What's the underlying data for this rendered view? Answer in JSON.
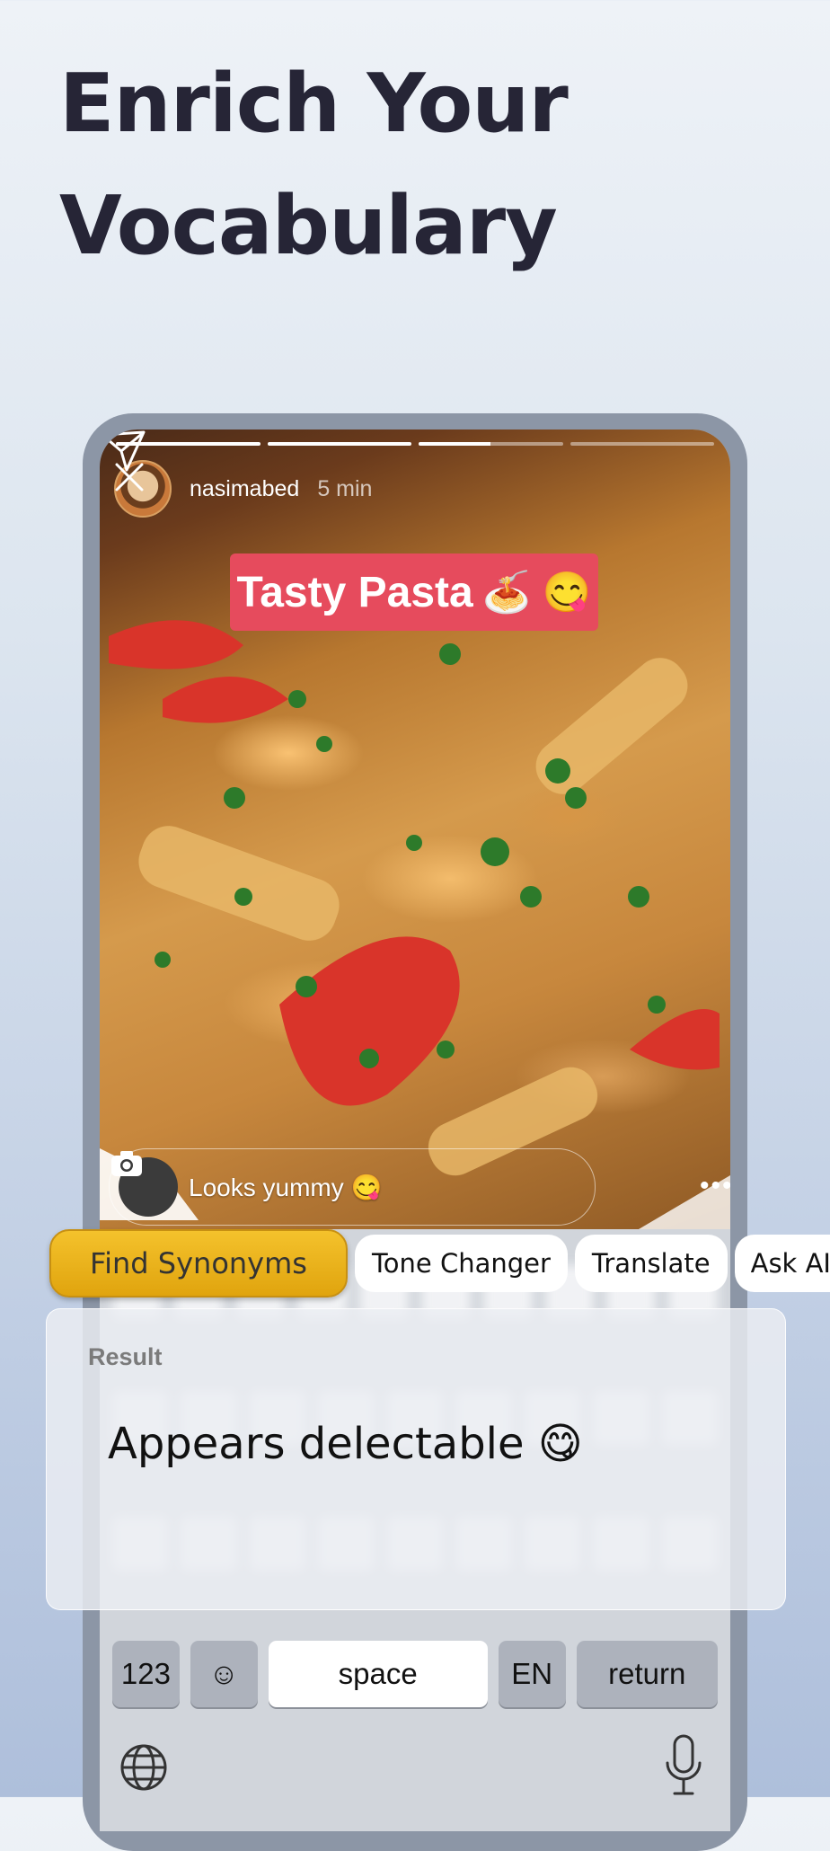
{
  "headline": {
    "line1": "Enrich Your",
    "line2": "Vocabulary"
  },
  "story": {
    "progress": [
      1.0,
      1.0,
      0.5,
      0.0
    ],
    "username": "nasimabed",
    "time": "5 min",
    "sticker_text": "Tasty Pasta",
    "sticker_emojis": "🍝 😋",
    "reply_text": "Looks yummy 😋"
  },
  "chips": [
    {
      "label": "Find Synonyms",
      "active": true
    },
    {
      "label": "Tone Changer",
      "active": false
    },
    {
      "label": "Translate",
      "active": false
    },
    {
      "label": "Ask AI",
      "active": false
    }
  ],
  "result": {
    "label": "Result",
    "text": "Appears delectable 😋"
  },
  "keyboard": {
    "numbers": "123",
    "emoji": "☺",
    "space": "space",
    "lang": "EN",
    "return": "return"
  },
  "colors": {
    "accent": "#f2bc25",
    "sticker": "#e64b5d",
    "headline": "#262536"
  }
}
